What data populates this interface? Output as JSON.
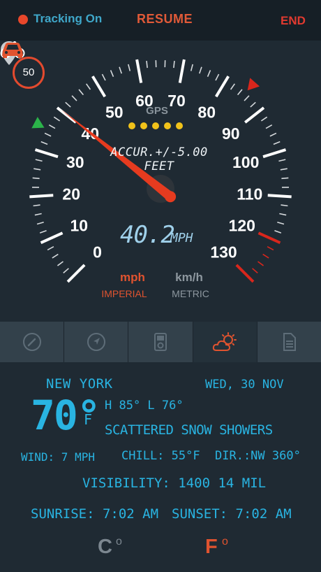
{
  "header": {
    "tracking_label": "Tracking On",
    "resume_label": "RESUME",
    "end_label": "END"
  },
  "speedometer": {
    "speed_limit": "50",
    "gps_label": "GPS",
    "gps_signal_bars": 5,
    "accuracy_text": "ACCUR.+/-5.00 FEET",
    "current_speed": "40.2",
    "current_speed_value": 40.2,
    "speed_unit": "MPH",
    "dial_labels": [
      "0",
      "10",
      "20",
      "30",
      "40",
      "50",
      "60",
      "70",
      "80",
      "90",
      "100",
      "110",
      "120",
      "130"
    ],
    "dial_max": 130,
    "limit_marker_speed": 35,
    "max_marker_speed": 85,
    "redzone_from": 120,
    "colors": {
      "needle": "#e63b1f",
      "limit_marker": "#2bb34a",
      "max_marker": "#d9261c",
      "redzone": "#d9261c"
    }
  },
  "units": {
    "imperial_main": "mph",
    "imperial_sub": "IMPERIAL",
    "metric_main": "km/h",
    "metric_sub": "METRIC"
  },
  "mode_icons": {
    "left": "bicycle-icon",
    "right": "car-icon"
  },
  "tabs": [
    {
      "icon": "speedometer-icon"
    },
    {
      "icon": "compass-icon"
    },
    {
      "icon": "ipod-icon"
    },
    {
      "icon": "weather-icon"
    },
    {
      "icon": "document-icon"
    }
  ],
  "weather": {
    "city": "NEW YORK",
    "date": "WED, 30 NOV",
    "temperature": "70°",
    "temperature_unit": "F",
    "hi_lo": "H 85°  L 76°",
    "condition": "SCATTERED SNOW SHOWERS",
    "wind": "WIND: 7 MPH",
    "chill": "CHILL: 55°F",
    "direction": "DIR.:NW 360°",
    "visibility": "VISIBILITY: 1400  14 MIL",
    "sunrise": "SUNRISE: 7:02 AM",
    "sunset": "SUNSET: 7:02 AM",
    "celsius_label": "C",
    "fahrenheit_label": "F",
    "degree_symbol": "o"
  }
}
